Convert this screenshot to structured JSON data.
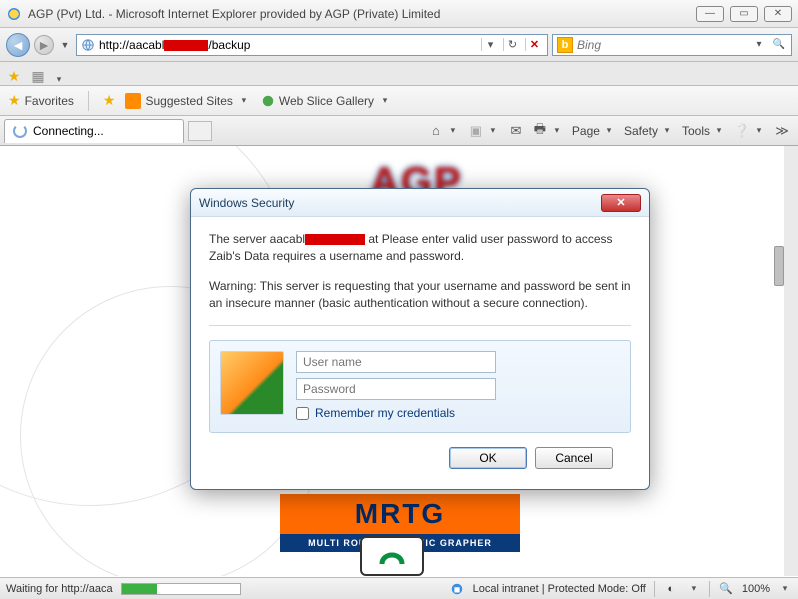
{
  "window": {
    "title": "AGP (Pvt) Ltd. - Microsoft Internet Explorer provided by AGP (Private) Limited"
  },
  "address": {
    "prefix": "http://aacabl",
    "suffix": "/backup"
  },
  "search": {
    "placeholder": "Bing"
  },
  "favbar": {
    "favorites": "Favorites",
    "suggested": "Suggested Sites",
    "webslice": "Web Slice Gallery"
  },
  "tab": {
    "label": "Connecting..."
  },
  "commands": {
    "page": "Page",
    "safety": "Safety",
    "tools": "Tools"
  },
  "mrtg": {
    "top": "MRTG",
    "bottom": "MULTI ROUTER TRAFFIC GRAPHER"
  },
  "dialog": {
    "title": "Windows Security",
    "msg1a": "The server aacabl",
    "msg1b": " at Please enter valid user password to access Zaib's Data requires a username and password.",
    "msg2": "Warning: This server is requesting that your username and password be sent in an insecure manner (basic authentication without a secure connection).",
    "user_placeholder": "User name",
    "pass_placeholder": "Password",
    "remember": "Remember my credentials",
    "ok": "OK",
    "cancel": "Cancel"
  },
  "status": {
    "waiting": "Waiting for http://aaca",
    "zone": "Local intranet | Protected Mode: Off",
    "zoom": "100%"
  }
}
